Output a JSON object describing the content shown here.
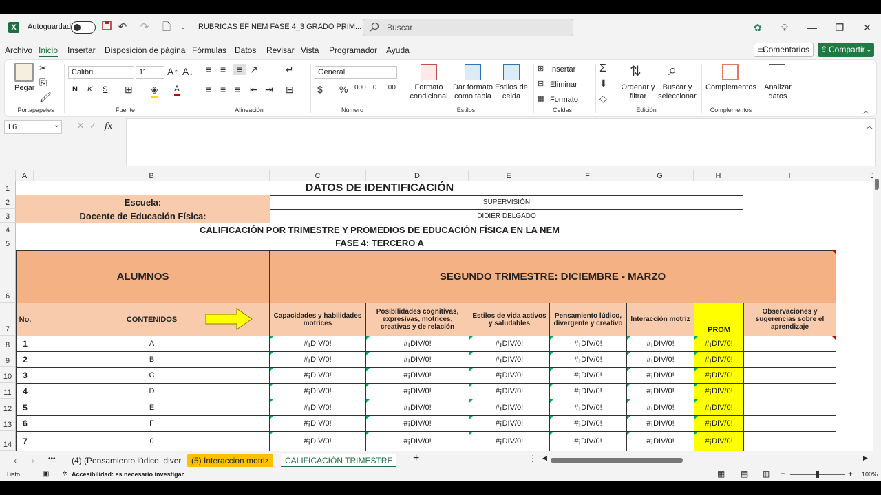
{
  "app": {
    "autosave_label": "Autoguardado",
    "filename": "RUBRICAS EF NEM FASE 4_3 GRADO PRIM...",
    "search_placeholder": "Buscar",
    "excel_letter": "X"
  },
  "menu": [
    "Archivo",
    "Inicio",
    "Insertar",
    "Disposición de página",
    "Fórmulas",
    "Datos",
    "Revisar",
    "Vista",
    "Programador",
    "Ayuda"
  ],
  "actions": {
    "comments": "Comentarios",
    "share": "Compartir"
  },
  "ribbon": {
    "paste": "Pegar",
    "portapapeles": "Portapapeles",
    "font_name": "Calibri",
    "font_size": "11",
    "fuente": "Fuente",
    "bold": "N",
    "italic": "K",
    "underline": "S",
    "alineacion": "Alineación",
    "number_format": "General",
    "numero": "Número",
    "cond_format_1": "Formato",
    "cond_format_2": "condicional",
    "table_format_1": "Dar formato",
    "table_format_2": "como tabla",
    "cell_styles_1": "Estilos de",
    "cell_styles_2": "celda",
    "estilos": "Estilos",
    "insert": "Insertar",
    "delete": "Eliminar",
    "format": "Formato",
    "celdas": "Celdas",
    "sort_1": "Ordenar y",
    "sort_2": "filtrar",
    "find_1": "Buscar y",
    "find_2": "seleccionar",
    "edicion": "Edición",
    "addins": "Complementos",
    "addins_group": "Complementos",
    "analyze_1": "Analizar",
    "analyze_2": "datos"
  },
  "formula": {
    "name_box": "L6",
    "fx": "fx",
    "value": ""
  },
  "columns": [
    "A",
    "B",
    "C",
    "D",
    "E",
    "F",
    "G",
    "H",
    "I",
    "J"
  ],
  "rows": [
    "1",
    "2",
    "3",
    "4",
    "5",
    "6",
    "7",
    "8",
    "9",
    "10",
    "11",
    "12",
    "13",
    "14"
  ],
  "sheet": {
    "title": "DATOS DE IDENTIFICACIÓN",
    "escuela_label": "Escuela:",
    "escuela_value": "SUPERVISIÓN",
    "docente_label": "Docente de Educación Física:",
    "docente_value": "DIDIER DELGADO",
    "heading": "CALIFICACIÓN POR TRIMESTRE Y PROMEDIOS DE EDUCACIÓN FÍSICA EN LA NEM",
    "fase": "FASE 4:  TERCERO A",
    "alumnos": "ALUMNOS",
    "trimestre": "SEGUNDO  TRIMESTRE: DICIEMBRE - MARZO",
    "no": "No.",
    "contenidos": "CONTENIDOS",
    "col_c": "Capacidades y habilidades motrices",
    "col_d": "Posibilidades cognitivas, expresivas,  motrices, creativas y de relación",
    "col_e": "Estilos de vida activos y saludables",
    "col_f": "Pensamiento lúdico, divergente y creativo",
    "col_g": "Interacción motriz",
    "col_h": "PROM",
    "col_i": "Observaciones y sugerencias sobre el aprendizaje",
    "students": [
      {
        "no": "1",
        "name": "A",
        "v": "#¡DIV/0!"
      },
      {
        "no": "2",
        "name": "B",
        "v": "#¡DIV/0!"
      },
      {
        "no": "3",
        "name": "C",
        "v": "#¡DIV/0!"
      },
      {
        "no": "4",
        "name": "D",
        "v": "#¡DIV/0!"
      },
      {
        "no": "5",
        "name": "E",
        "v": "#¡DIV/0!"
      },
      {
        "no": "6",
        "name": "F",
        "v": "#¡DIV/0!"
      },
      {
        "no": "7",
        "name": "0",
        "v": "#¡DIV/0!"
      }
    ]
  },
  "tabs": {
    "t1": "(4) (Pensamiento lúdico, diver",
    "t2": "(5) Interaccion motriz",
    "t3": "CALIFICACIÓN  TRIMESTRE",
    "more": "•••",
    "add": "+"
  },
  "status": {
    "ready": "Listo",
    "accessibility": "Accesibilidad: es necesario investigar",
    "zoom": "100%"
  },
  "colors": {
    "salmon": "#f8cbad",
    "orange": "#f4b183",
    "yellow": "#ffff00",
    "excel_green": "#1d6f42"
  }
}
